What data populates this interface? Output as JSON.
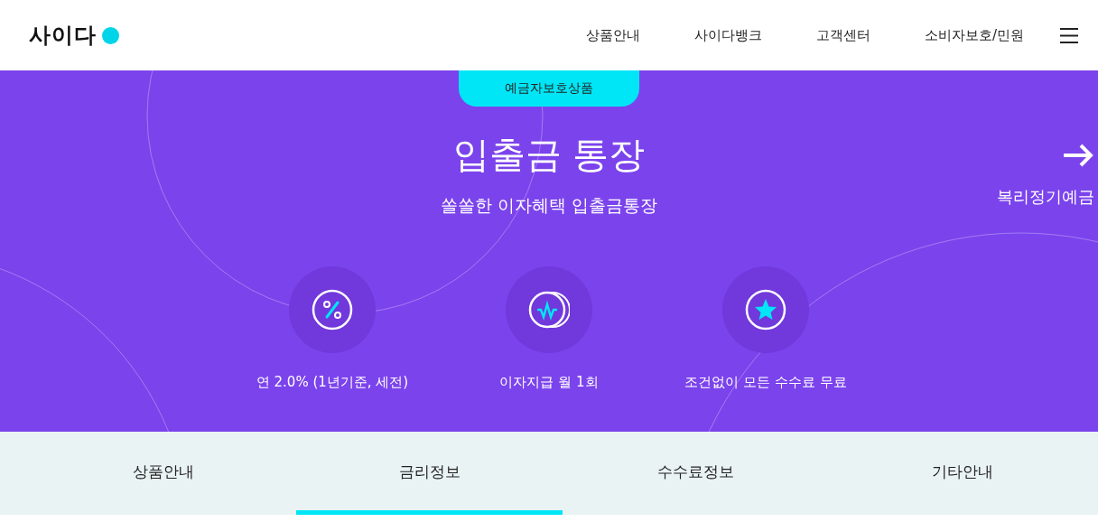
{
  "header": {
    "logo": "사이다",
    "nav": [
      "상품안내",
      "사이다뱅크",
      "고객센터",
      "소비자보호/민원"
    ]
  },
  "hero": {
    "badge": "예금자보호상품",
    "title": "입출금 통장",
    "subtitle": "쏠쏠한 이자혜택 입출금통장",
    "next_link": "복리정기예금",
    "features": [
      {
        "kind": "percent",
        "label": "연 2.0% (1년기준, 세전)"
      },
      {
        "kind": "won",
        "label": "이자지급 월 1회"
      },
      {
        "kind": "star",
        "label": "조건없이 모든 수수료 무료"
      }
    ]
  },
  "tabs": [
    {
      "label": "상품안내",
      "selected": false
    },
    {
      "label": "금리정보",
      "selected": true
    },
    {
      "label": "수수료정보",
      "selected": false
    },
    {
      "label": "기타안내",
      "selected": false
    }
  ]
}
